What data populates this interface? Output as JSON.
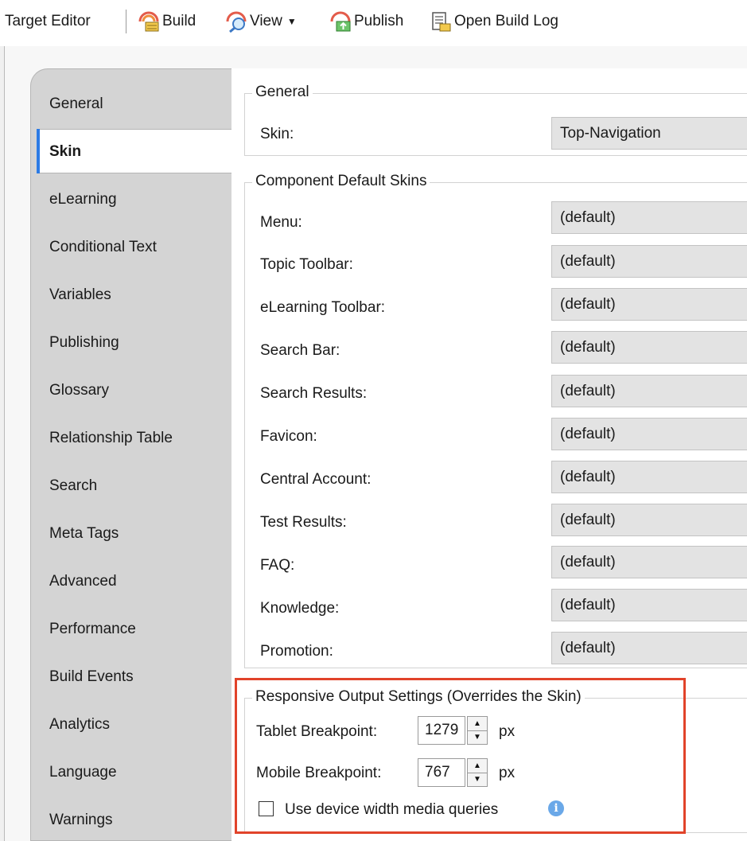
{
  "toolbar": {
    "title": "Target Editor",
    "build": "Build",
    "view": "View",
    "publish": "Publish",
    "open_build_log": "Open Build Log"
  },
  "tabs": [
    {
      "label": "General"
    },
    {
      "label": "Skin",
      "active": true
    },
    {
      "label": "eLearning"
    },
    {
      "label": "Conditional Text"
    },
    {
      "label": "Variables"
    },
    {
      "label": "Publishing"
    },
    {
      "label": "Glossary"
    },
    {
      "label": "Relationship Table"
    },
    {
      "label": "Search"
    },
    {
      "label": "Meta Tags"
    },
    {
      "label": "Advanced"
    },
    {
      "label": "Performance"
    },
    {
      "label": "Build Events"
    },
    {
      "label": "Analytics"
    },
    {
      "label": "Language"
    },
    {
      "label": "Warnings"
    }
  ],
  "general_group": {
    "title": "General",
    "skin_label": "Skin:",
    "skin_value": "Top-Navigation"
  },
  "component_group": {
    "title": "Component Default Skins",
    "rows": [
      {
        "label": "Menu:",
        "value": "(default)"
      },
      {
        "label": "Topic Toolbar:",
        "value": "(default)"
      },
      {
        "label": "eLearning Toolbar:",
        "value": "(default)"
      },
      {
        "label": "Search Bar:",
        "value": "(default)"
      },
      {
        "label": "Search Results:",
        "value": "(default)"
      },
      {
        "label": "Favicon:",
        "value": "(default)"
      },
      {
        "label": "Central Account:",
        "value": "(default)"
      },
      {
        "label": "Test Results:",
        "value": "(default)"
      },
      {
        "label": "FAQ:",
        "value": "(default)"
      },
      {
        "label": "Knowledge:",
        "value": "(default)"
      },
      {
        "label": "Promotion:",
        "value": "(default)"
      }
    ]
  },
  "responsive_group": {
    "title": "Responsive Output Settings (Overrides the Skin)",
    "tablet_label": "Tablet Breakpoint:",
    "tablet_value": "1279",
    "mobile_label": "Mobile Breakpoint:",
    "mobile_value": "767",
    "unit": "px",
    "device_width_label": "Use device width media queries",
    "device_width_checked": false
  },
  "colors": {
    "highlight": "#e1432a",
    "active_tab_accent": "#2c7be5",
    "info_icon": "#6aa8e8"
  },
  "icons": [
    "build-icon",
    "view-icon",
    "dropdown-arrow-icon",
    "publish-icon",
    "build-log-icon",
    "spin-up-icon",
    "spin-down-icon",
    "info-icon"
  ]
}
